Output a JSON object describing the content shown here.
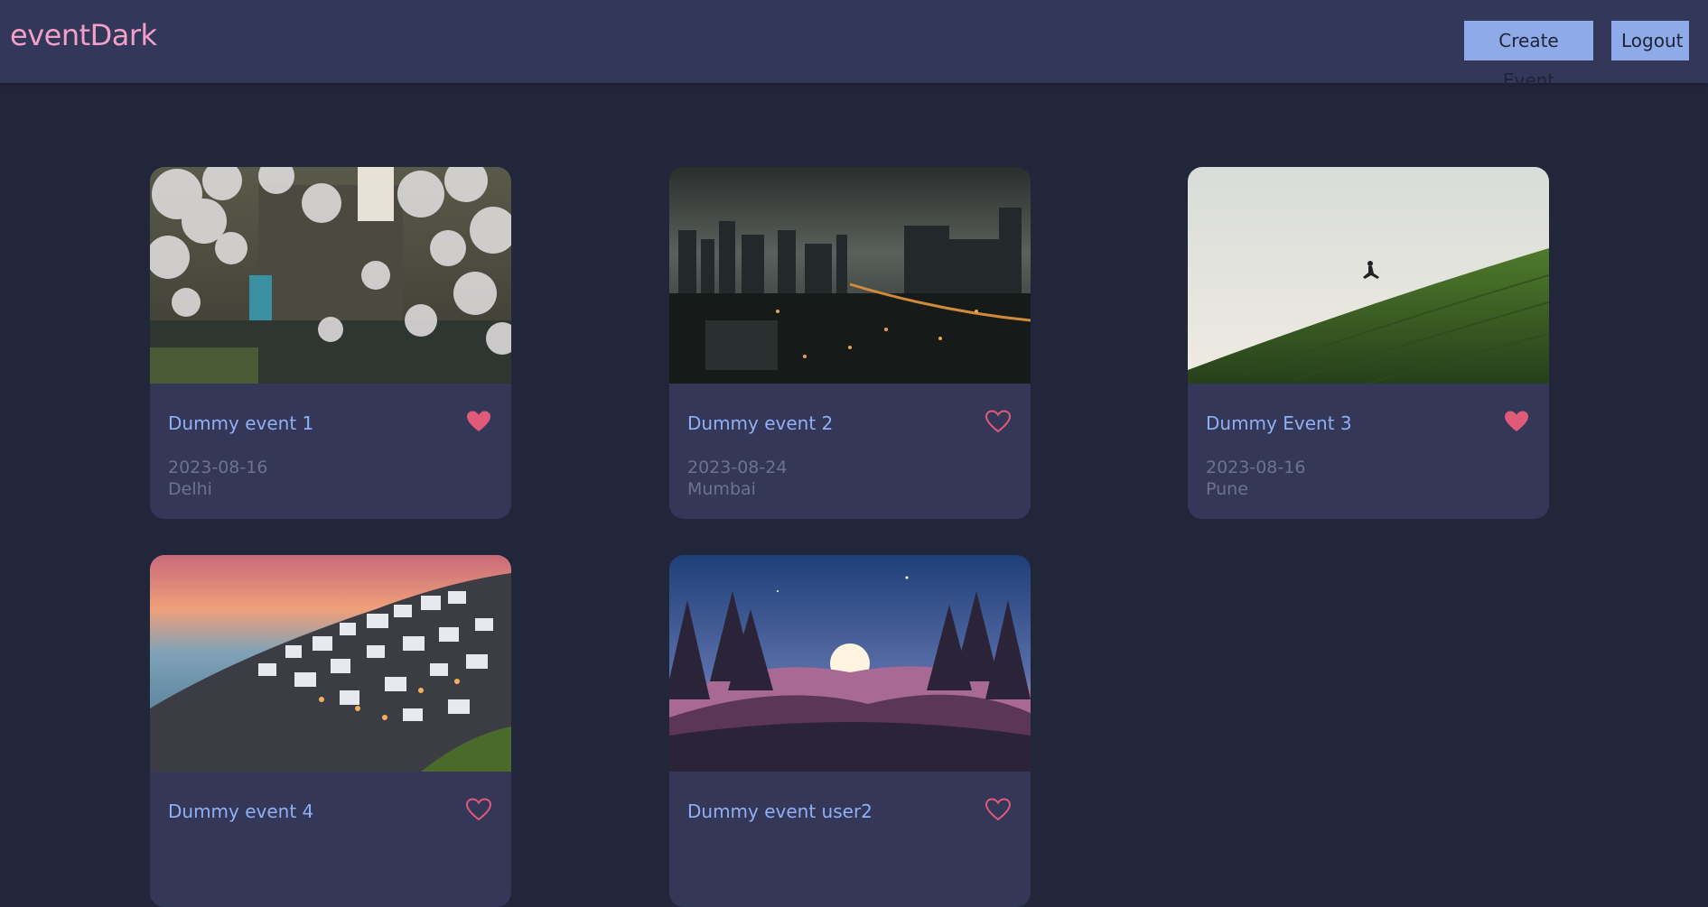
{
  "app": {
    "brand": "eventDark",
    "buttons": {
      "create": "Create Event",
      "logout": "Logout"
    }
  },
  "colors": {
    "background": "#22263a",
    "navbar": "#33375a",
    "brand": "#f2a0c8",
    "button": "#8faae8",
    "card": "#343758",
    "title": "#8fb0f4",
    "meta": "#6e7290",
    "heart": "#e05a7a"
  },
  "events": [
    {
      "title": "Dummy event 1",
      "date": "2023-08-16",
      "city": "Delhi",
      "liked": true,
      "image_icon": "cherry-blossom-street-image"
    },
    {
      "title": "Dummy event 2",
      "date": "2023-08-24",
      "city": "Mumbai",
      "liked": false,
      "image_icon": "night-city-image"
    },
    {
      "title": "Dummy Event 3",
      "date": "2023-08-16",
      "city": "Pune",
      "liked": true,
      "image_icon": "green-hill-image"
    },
    {
      "title": "Dummy event 4",
      "date": "",
      "city": "",
      "liked": false,
      "image_icon": "coastal-village-image"
    },
    {
      "title": "Dummy event user2",
      "date": "",
      "city": "",
      "liked": false,
      "image_icon": "forest-sunset-image"
    }
  ]
}
